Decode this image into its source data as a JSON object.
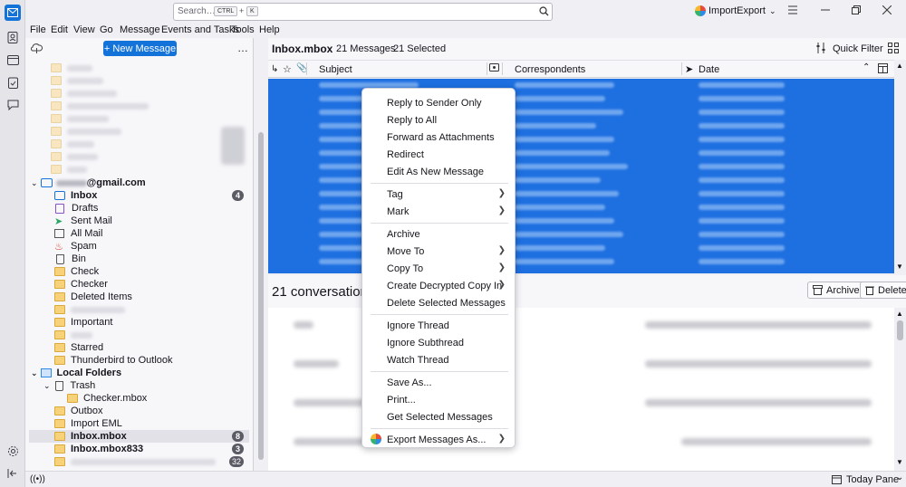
{
  "search": {
    "placeholder": "Search…",
    "kbd1": "CTRL",
    "plus": "+",
    "kbd2": "K"
  },
  "titlebar": {
    "profile_label": "ImportExport"
  },
  "menubar": [
    "File",
    "Edit",
    "View",
    "Go",
    "Message",
    "Events and Tasks",
    "Tools",
    "Help"
  ],
  "folderpane": {
    "new_message_label": "+ New Message",
    "more": "…",
    "account_email": "@gmail.com",
    "folders": [
      {
        "label": "Inbox",
        "badge": "4",
        "bold": true
      },
      {
        "label": "Drafts"
      },
      {
        "label": "Sent Mail"
      },
      {
        "label": "All Mail"
      },
      {
        "label": "Spam"
      },
      {
        "label": "Bin"
      },
      {
        "label": "Check"
      },
      {
        "label": "Checker"
      },
      {
        "label": "Deleted Items"
      },
      {
        "label": ""
      },
      {
        "label": "Important"
      },
      {
        "label": ""
      },
      {
        "label": "Starred"
      },
      {
        "label": "Thunderbird to Outlook"
      }
    ],
    "local_folders_label": "Local Folders",
    "trash_label": "Trash",
    "checker_mbox_label": "Checker.mbox",
    "outbox_label": "Outbox",
    "import_eml_label": "Import EML",
    "inbox_mbox_label": "Inbox.mbox",
    "inbox_mbox_badge": "8",
    "inbox_mbox833_label": "Inbox.mbox833",
    "inbox_mbox833_badge": "3",
    "last_badge": "32"
  },
  "threadpane": {
    "folder_name": "Inbox.mbox",
    "message_count": "21 Messages",
    "selected_count": "21 Selected",
    "quick_filter_label": "Quick Filter",
    "col_subject": "Subject",
    "col_correspondents": "Correspondents",
    "col_date": "Date"
  },
  "preview": {
    "heading": "21 conversation",
    "archive_label": "Archive",
    "delete_label": "Delete"
  },
  "context_menu": {
    "reply_sender_only": "Reply to Sender Only",
    "reply_all": "Reply to All",
    "forward_attachments": "Forward as Attachments",
    "redirect": "Redirect",
    "edit_as_new": "Edit As New Message",
    "tag": "Tag",
    "mark": "Mark",
    "archive": "Archive",
    "move_to": "Move To",
    "copy_to": "Copy To",
    "create_decrypted_copy": "Create Decrypted Copy In",
    "delete_selected": "Delete Selected Messages",
    "ignore_thread": "Ignore Thread",
    "ignore_subthread": "Ignore Subthread",
    "watch_thread": "Watch Thread",
    "save_as": "Save As...",
    "print": "Print...",
    "get_selected": "Get Selected Messages",
    "export_messages": "Export Messages As..."
  },
  "statusbar": {
    "today_pane_label": "Today Pane"
  },
  "colors": {
    "accent": "#1e6fe0",
    "selection": "#1e6fe0",
    "new_message_bg": "#1373d9"
  }
}
